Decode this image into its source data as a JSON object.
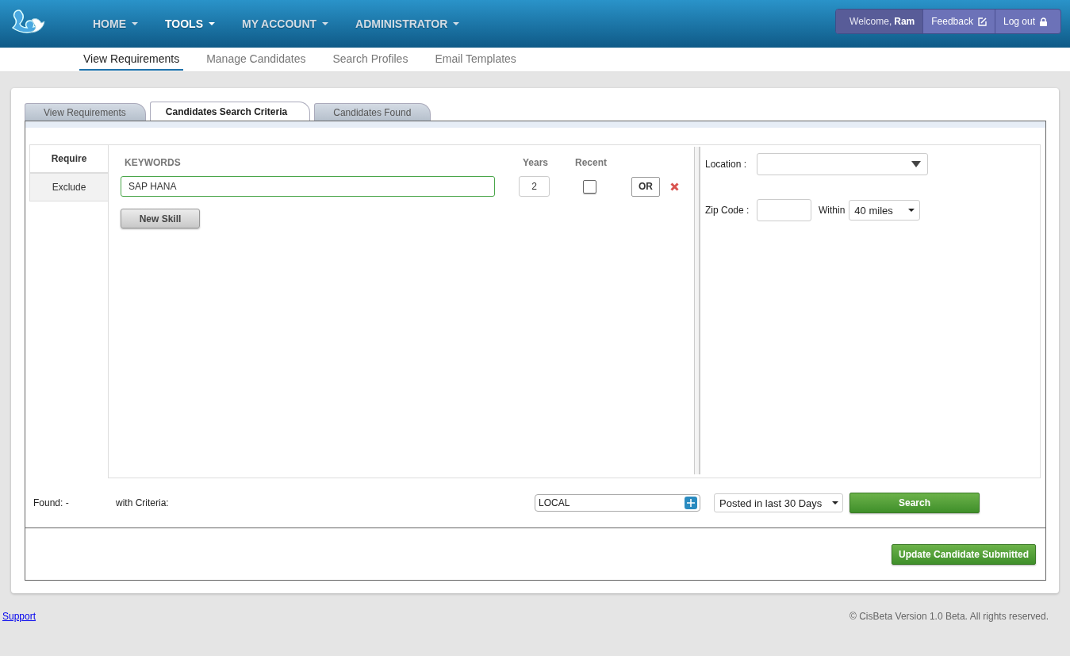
{
  "header": {
    "nav": [
      {
        "label": "HOME",
        "selected": false
      },
      {
        "label": "TOOLS",
        "selected": true
      },
      {
        "label": "MY ACCOUNT",
        "selected": false
      },
      {
        "label": "ADMINISTRATOR",
        "selected": false
      }
    ],
    "welcome": "Welcome, **Ram**",
    "feedback": "Feedback",
    "logout": "Log out"
  },
  "subnav": [
    {
      "label": "View Requirements",
      "selected": true
    },
    {
      "label": "Manage Candidates",
      "selected": false
    },
    {
      "label": "Search Profiles",
      "selected": false
    },
    {
      "label": "Email Templates",
      "selected": false
    }
  ],
  "tabs": [
    {
      "label": "View Requirements",
      "selected": false
    },
    {
      "label": "Candidates Search Criteria",
      "selected": true
    },
    {
      "label": "Candidates Found",
      "selected": false
    }
  ],
  "side_tabs": [
    {
      "label": "Require",
      "selected": true
    },
    {
      "label": "Exclude",
      "selected": false
    }
  ],
  "columns": {
    "keywords": "KEYWORDS",
    "years": "Years",
    "recent": "Recent"
  },
  "skills": [
    {
      "keyword": "SAP HANA",
      "years": "2",
      "recent": false,
      "operator": "OR"
    }
  ],
  "new_skill": "New Skill",
  "location": {
    "label": "Location :"
  },
  "zip": {
    "label": "Zip Code :",
    "within": "Within",
    "distance": "40 miles"
  },
  "found": {
    "label": "Found: -",
    "criteria": "with Criteria:"
  },
  "source": "LOCAL",
  "posted": "Posted in last 30 Days",
  "search": "Search",
  "update": "Update Candidate Submitted",
  "footer": {
    "support": "Support",
    "copyright": "© CisBeta Version 1.0 Beta. All rights reserved."
  }
}
